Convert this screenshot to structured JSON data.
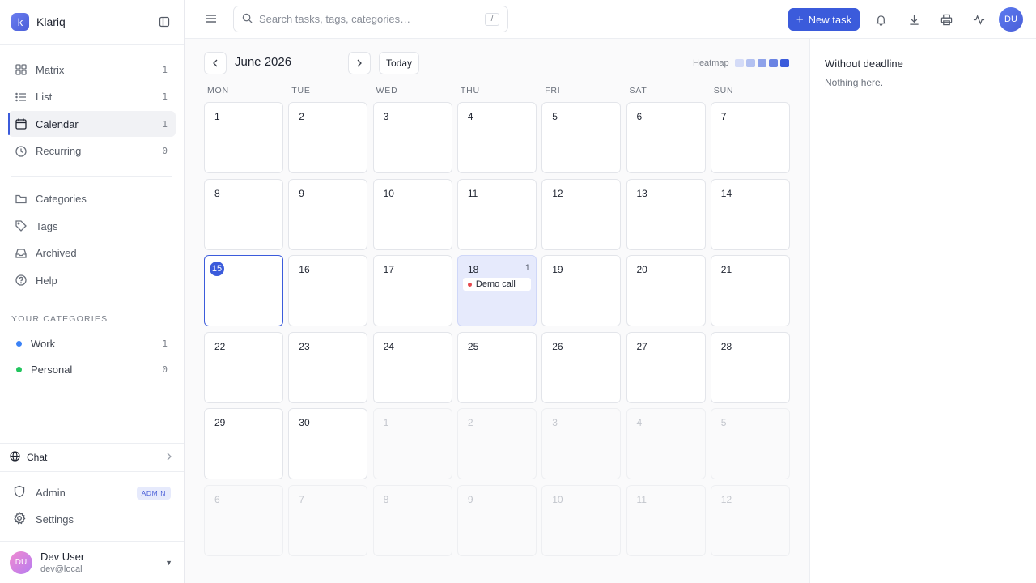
{
  "app": {
    "logo_letter": "k",
    "name": "Klariq"
  },
  "sidebar": {
    "nav": [
      {
        "label": "Matrix",
        "count": "1",
        "icon": "grid-icon"
      },
      {
        "label": "List",
        "count": "1",
        "icon": "list-icon"
      },
      {
        "label": "Calendar",
        "count": "1",
        "icon": "calendar-icon",
        "active": true
      },
      {
        "label": "Recurring",
        "count": "0",
        "icon": "clock-icon"
      }
    ],
    "secondary": [
      {
        "label": "Categories",
        "icon": "folder-icon"
      },
      {
        "label": "Tags",
        "icon": "tag-icon"
      },
      {
        "label": "Archived",
        "icon": "inbox-icon"
      },
      {
        "label": "Help",
        "icon": "help-icon"
      }
    ],
    "categories_title": "YOUR CATEGORIES",
    "categories": [
      {
        "label": "Work",
        "count": "1",
        "color": "#3b82f6"
      },
      {
        "label": "Personal",
        "count": "0",
        "color": "#22c55e"
      }
    ],
    "chat_label": "Chat",
    "admin_label": "Admin",
    "admin_badge": "ADMIN",
    "settings_label": "Settings",
    "user": {
      "initials": "DU",
      "name": "Dev User",
      "email": "dev@local"
    }
  },
  "header": {
    "search_placeholder": "Search tasks, tags, categories…",
    "search_shortcut": "/",
    "new_task_label": "New task",
    "avatar_initials": "DU"
  },
  "calendar": {
    "month_title": "June 2026",
    "today_label": "Today",
    "heatmap_label": "Heatmap",
    "heatmap_colors": [
      "#d4dbf7",
      "#b3c1f1",
      "#8ea2ea",
      "#6a83e3",
      "#3b5bdb"
    ],
    "weekdays": [
      "MON",
      "TUE",
      "WED",
      "THU",
      "FRI",
      "SAT",
      "SUN"
    ],
    "weeks": [
      [
        {
          "d": "1"
        },
        {
          "d": "2"
        },
        {
          "d": "3"
        },
        {
          "d": "4"
        },
        {
          "d": "5"
        },
        {
          "d": "6"
        },
        {
          "d": "7"
        }
      ],
      [
        {
          "d": "8"
        },
        {
          "d": "9"
        },
        {
          "d": "10"
        },
        {
          "d": "11"
        },
        {
          "d": "12"
        },
        {
          "d": "13"
        },
        {
          "d": "14"
        }
      ],
      [
        {
          "d": "15",
          "today": true
        },
        {
          "d": "16"
        },
        {
          "d": "17"
        },
        {
          "d": "18",
          "count": "1",
          "tasks": [
            {
              "title": "Demo call",
              "color": "#e5484d"
            }
          ]
        },
        {
          "d": "19"
        },
        {
          "d": "20"
        },
        {
          "d": "21"
        }
      ],
      [
        {
          "d": "22"
        },
        {
          "d": "23"
        },
        {
          "d": "24"
        },
        {
          "d": "25"
        },
        {
          "d": "26"
        },
        {
          "d": "27"
        },
        {
          "d": "28"
        }
      ],
      [
        {
          "d": "29"
        },
        {
          "d": "30"
        },
        {
          "d": "1",
          "other": true
        },
        {
          "d": "2",
          "other": true
        },
        {
          "d": "3",
          "other": true
        },
        {
          "d": "4",
          "other": true
        },
        {
          "d": "5",
          "other": true
        }
      ],
      [
        {
          "d": "6",
          "other": true
        },
        {
          "d": "7",
          "other": true
        },
        {
          "d": "8",
          "other": true
        },
        {
          "d": "9",
          "other": true
        },
        {
          "d": "10",
          "other": true
        },
        {
          "d": "11",
          "other": true
        },
        {
          "d": "12",
          "other": true
        }
      ]
    ]
  },
  "right_panel": {
    "title": "Without deadline",
    "empty_text": "Nothing here."
  }
}
